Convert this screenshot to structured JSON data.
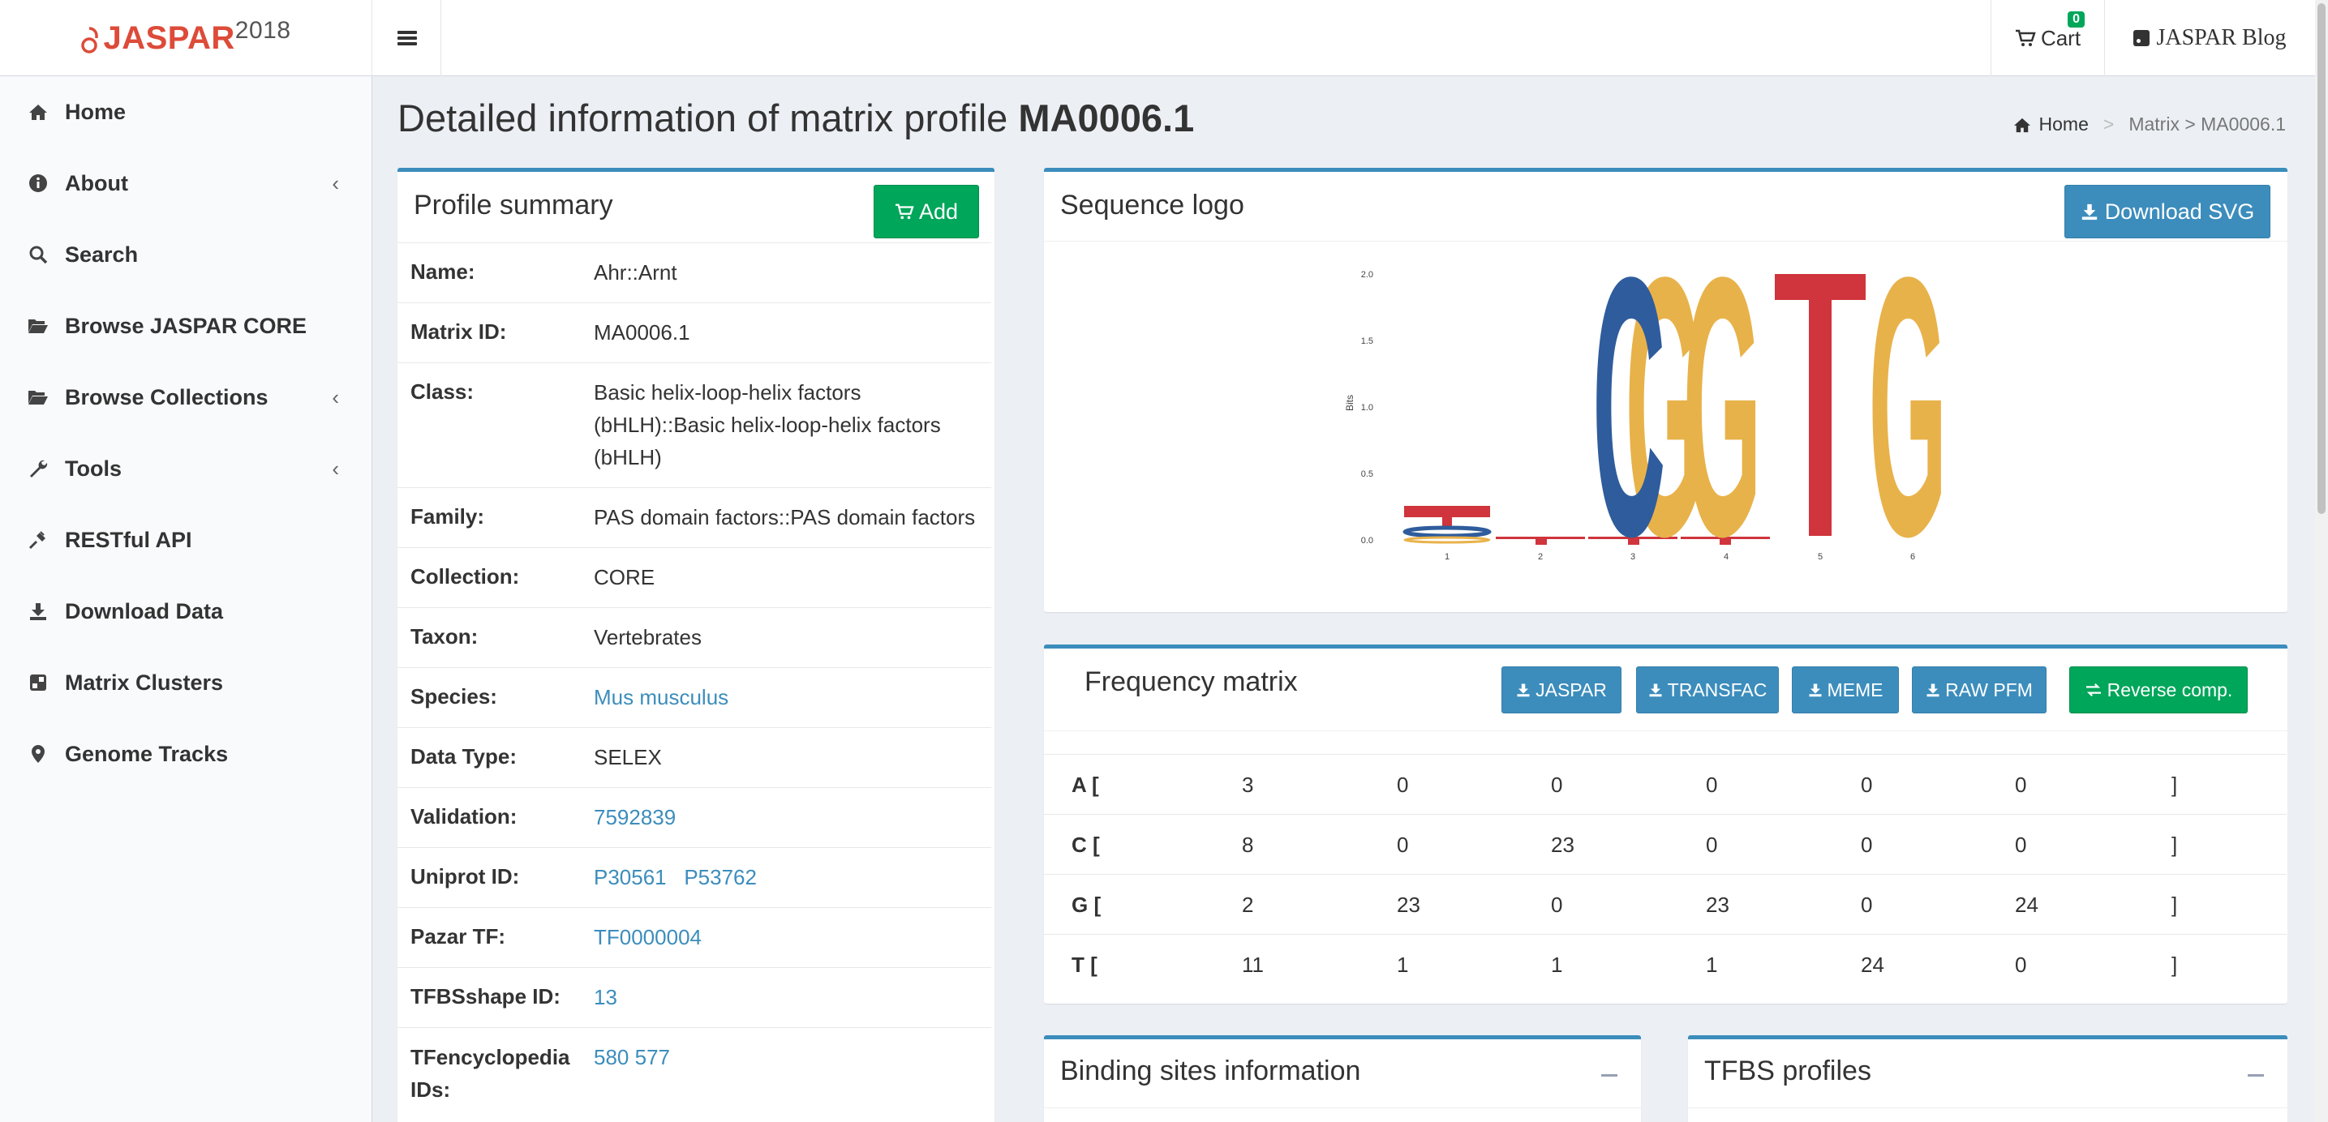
{
  "header": {
    "logo_text": "JASPAR",
    "logo_year": "2018",
    "cart_label": "Cart",
    "cart_count": "0",
    "blog_label": "JASPAR Blog",
    "colors": {
      "logo": "#dd4b39",
      "primary": "#3c8dbc",
      "success": "#00a65a"
    }
  },
  "sidebar": {
    "items": [
      {
        "label": "Home",
        "icon": "home-icon"
      },
      {
        "label": "About",
        "icon": "info-icon",
        "chevron": true
      },
      {
        "label": "Search",
        "icon": "search-icon"
      },
      {
        "label": "Browse JASPAR CORE",
        "icon": "folder-open-icon"
      },
      {
        "label": "Browse Collections",
        "icon": "folder-open-icon",
        "chevron": true
      },
      {
        "label": "Tools",
        "icon": "wrench-icon",
        "chevron": true
      },
      {
        "label": "RESTful API",
        "icon": "plug-icon"
      },
      {
        "label": "Download Data",
        "icon": "download-icon"
      },
      {
        "label": "Matrix Clusters",
        "icon": "clusters-icon"
      },
      {
        "label": "Genome Tracks",
        "icon": "map-marker-icon"
      }
    ]
  },
  "page": {
    "title_prefix": "Detailed information of matrix profile",
    "title_id": "MA0006.1",
    "breadcrumb": {
      "home": "Home",
      "separator": ">",
      "current": "Matrix > MA0006.1"
    }
  },
  "profile_summary": {
    "title": "Profile summary",
    "add_label": "Add",
    "rows": [
      {
        "key": "Name:",
        "value": "Ahr::Arnt"
      },
      {
        "key": "Matrix ID:",
        "value": "MA0006.1"
      },
      {
        "key": "Class:",
        "value": "Basic helix-loop-helix factors (bHLH)::Basic helix-loop-helix factors (bHLH)"
      },
      {
        "key": "Family:",
        "value": "PAS domain factors::PAS domain factors"
      },
      {
        "key": "Collection:",
        "value": "CORE"
      },
      {
        "key": "Taxon:",
        "value": "Vertebrates"
      },
      {
        "key": "Species:",
        "value": "Mus musculus",
        "link": true
      },
      {
        "key": "Data Type:",
        "value": "SELEX"
      },
      {
        "key": "Validation:",
        "value": "7592839",
        "link": true
      },
      {
        "key": "Uniprot ID:",
        "value": "P30561   P53762",
        "link": true
      },
      {
        "key": "Pazar TF:",
        "value": "TF0000004",
        "link": true
      },
      {
        "key": "TFBSshape ID:",
        "value": "13",
        "link": true
      },
      {
        "key": "TFencyclopedia IDs:",
        "value": "580 577",
        "link": true
      }
    ]
  },
  "sequence_logo": {
    "title": "Sequence logo",
    "download_label": "Download SVG",
    "y_axis_label": "Bits",
    "y_ticks": [
      "2.0",
      "1.5",
      "1.0",
      "0.5",
      "0.0"
    ],
    "x_ticks": [
      "1",
      "2",
      "3",
      "4",
      "5",
      "6"
    ],
    "letters": [
      "G",
      "C",
      "G",
      "T",
      "G"
    ],
    "letter_colors": {
      "A": "#2aa12a",
      "C": "#2f5c9c",
      "G": "#e8b24a",
      "T": "#d0343c"
    }
  },
  "frequency_matrix": {
    "title": "Frequency matrix",
    "buttons": [
      "JASPAR",
      "TRANSFAC",
      "MEME",
      "RAW PFM",
      "Reverse comp."
    ],
    "rows": [
      {
        "label": "A  [",
        "values": [
          "3",
          "0",
          "0",
          "0",
          "0",
          "0"
        ],
        "end": "]"
      },
      {
        "label": "C  [",
        "values": [
          "8",
          "0",
          "23",
          "0",
          "0",
          "0"
        ],
        "end": "]"
      },
      {
        "label": "G  [",
        "values": [
          "2",
          "23",
          "0",
          "23",
          "0",
          "24"
        ],
        "end": "]"
      },
      {
        "label": "T  [",
        "values": [
          "11",
          "1",
          "1",
          "1",
          "24",
          "0"
        ],
        "end": "]"
      }
    ]
  },
  "binding_sites": {
    "title": "Binding sites information"
  },
  "tfbs_profiles": {
    "title": "TFBS profiles"
  }
}
